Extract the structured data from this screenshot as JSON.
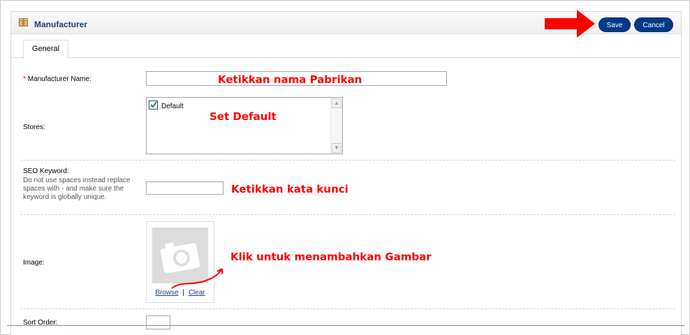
{
  "header": {
    "title": "Manufacturer",
    "save_label": "Save",
    "cancel_label": "Cancel"
  },
  "tabs": [
    {
      "label": "General"
    }
  ],
  "form": {
    "manufacturer_name": {
      "required_mark": "*",
      "label": "Manufacturer Name:",
      "value": ""
    },
    "stores": {
      "label": "Stores:",
      "options": [
        {
          "label": "Default",
          "checked": true
        }
      ]
    },
    "seo_keyword": {
      "label": "SEO Keyword:",
      "help": "Do not use spaces instead replace spaces with - and make sure the keyword is globally unique.",
      "value": ""
    },
    "image": {
      "label": "Image:",
      "browse_label": "Browse",
      "separator": "|",
      "clear_label": "Clear"
    },
    "sort_order": {
      "label": "Sort Order:",
      "value": ""
    }
  },
  "annotations": {
    "name": "Ketikkan nama Pabrikan",
    "stores": "Set Default",
    "seo": "Ketikkan kata kunci",
    "image": "Klik untuk menambahkan Gambar"
  },
  "colors": {
    "button_bg": "#003a88",
    "title": "#1a3f70",
    "annotation": "#ff0000"
  },
  "icons": {
    "header": "package-icon",
    "save_pointer": "red-arrow-icon",
    "check": "check-icon",
    "photo": "camera-icon"
  }
}
